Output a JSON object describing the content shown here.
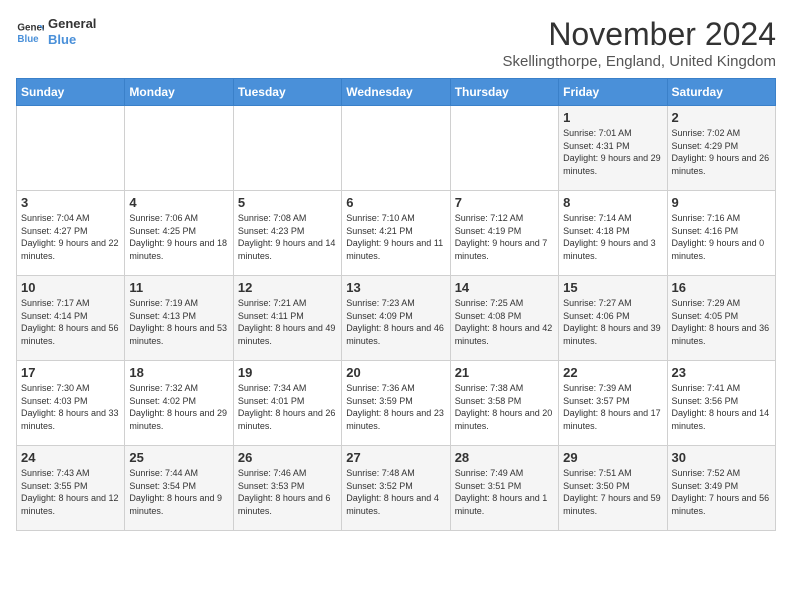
{
  "header": {
    "logo_line1": "General",
    "logo_line2": "Blue",
    "month_title": "November 2024",
    "location": "Skellingthorpe, England, United Kingdom"
  },
  "days_of_week": [
    "Sunday",
    "Monday",
    "Tuesday",
    "Wednesday",
    "Thursday",
    "Friday",
    "Saturday"
  ],
  "weeks": [
    [
      {
        "day": "",
        "info": ""
      },
      {
        "day": "",
        "info": ""
      },
      {
        "day": "",
        "info": ""
      },
      {
        "day": "",
        "info": ""
      },
      {
        "day": "",
        "info": ""
      },
      {
        "day": "1",
        "info": "Sunrise: 7:01 AM\nSunset: 4:31 PM\nDaylight: 9 hours and 29 minutes."
      },
      {
        "day": "2",
        "info": "Sunrise: 7:02 AM\nSunset: 4:29 PM\nDaylight: 9 hours and 26 minutes."
      }
    ],
    [
      {
        "day": "3",
        "info": "Sunrise: 7:04 AM\nSunset: 4:27 PM\nDaylight: 9 hours and 22 minutes."
      },
      {
        "day": "4",
        "info": "Sunrise: 7:06 AM\nSunset: 4:25 PM\nDaylight: 9 hours and 18 minutes."
      },
      {
        "day": "5",
        "info": "Sunrise: 7:08 AM\nSunset: 4:23 PM\nDaylight: 9 hours and 14 minutes."
      },
      {
        "day": "6",
        "info": "Sunrise: 7:10 AM\nSunset: 4:21 PM\nDaylight: 9 hours and 11 minutes."
      },
      {
        "day": "7",
        "info": "Sunrise: 7:12 AM\nSunset: 4:19 PM\nDaylight: 9 hours and 7 minutes."
      },
      {
        "day": "8",
        "info": "Sunrise: 7:14 AM\nSunset: 4:18 PM\nDaylight: 9 hours and 3 minutes."
      },
      {
        "day": "9",
        "info": "Sunrise: 7:16 AM\nSunset: 4:16 PM\nDaylight: 9 hours and 0 minutes."
      }
    ],
    [
      {
        "day": "10",
        "info": "Sunrise: 7:17 AM\nSunset: 4:14 PM\nDaylight: 8 hours and 56 minutes."
      },
      {
        "day": "11",
        "info": "Sunrise: 7:19 AM\nSunset: 4:13 PM\nDaylight: 8 hours and 53 minutes."
      },
      {
        "day": "12",
        "info": "Sunrise: 7:21 AM\nSunset: 4:11 PM\nDaylight: 8 hours and 49 minutes."
      },
      {
        "day": "13",
        "info": "Sunrise: 7:23 AM\nSunset: 4:09 PM\nDaylight: 8 hours and 46 minutes."
      },
      {
        "day": "14",
        "info": "Sunrise: 7:25 AM\nSunset: 4:08 PM\nDaylight: 8 hours and 42 minutes."
      },
      {
        "day": "15",
        "info": "Sunrise: 7:27 AM\nSunset: 4:06 PM\nDaylight: 8 hours and 39 minutes."
      },
      {
        "day": "16",
        "info": "Sunrise: 7:29 AM\nSunset: 4:05 PM\nDaylight: 8 hours and 36 minutes."
      }
    ],
    [
      {
        "day": "17",
        "info": "Sunrise: 7:30 AM\nSunset: 4:03 PM\nDaylight: 8 hours and 33 minutes."
      },
      {
        "day": "18",
        "info": "Sunrise: 7:32 AM\nSunset: 4:02 PM\nDaylight: 8 hours and 29 minutes."
      },
      {
        "day": "19",
        "info": "Sunrise: 7:34 AM\nSunset: 4:01 PM\nDaylight: 8 hours and 26 minutes."
      },
      {
        "day": "20",
        "info": "Sunrise: 7:36 AM\nSunset: 3:59 PM\nDaylight: 8 hours and 23 minutes."
      },
      {
        "day": "21",
        "info": "Sunrise: 7:38 AM\nSunset: 3:58 PM\nDaylight: 8 hours and 20 minutes."
      },
      {
        "day": "22",
        "info": "Sunrise: 7:39 AM\nSunset: 3:57 PM\nDaylight: 8 hours and 17 minutes."
      },
      {
        "day": "23",
        "info": "Sunrise: 7:41 AM\nSunset: 3:56 PM\nDaylight: 8 hours and 14 minutes."
      }
    ],
    [
      {
        "day": "24",
        "info": "Sunrise: 7:43 AM\nSunset: 3:55 PM\nDaylight: 8 hours and 12 minutes."
      },
      {
        "day": "25",
        "info": "Sunrise: 7:44 AM\nSunset: 3:54 PM\nDaylight: 8 hours and 9 minutes."
      },
      {
        "day": "26",
        "info": "Sunrise: 7:46 AM\nSunset: 3:53 PM\nDaylight: 8 hours and 6 minutes."
      },
      {
        "day": "27",
        "info": "Sunrise: 7:48 AM\nSunset: 3:52 PM\nDaylight: 8 hours and 4 minutes."
      },
      {
        "day": "28",
        "info": "Sunrise: 7:49 AM\nSunset: 3:51 PM\nDaylight: 8 hours and 1 minute."
      },
      {
        "day": "29",
        "info": "Sunrise: 7:51 AM\nSunset: 3:50 PM\nDaylight: 7 hours and 59 minutes."
      },
      {
        "day": "30",
        "info": "Sunrise: 7:52 AM\nSunset: 3:49 PM\nDaylight: 7 hours and 56 minutes."
      }
    ]
  ]
}
